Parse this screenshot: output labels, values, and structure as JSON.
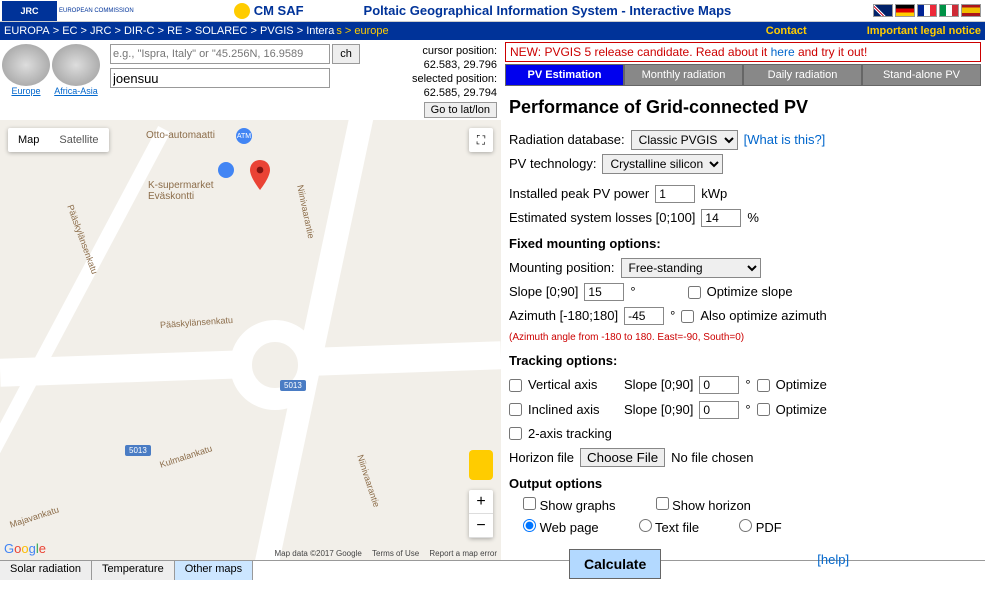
{
  "header": {
    "logo_jrc": "JRC",
    "logo_ec": "EUROPEAN COMMISSION",
    "cmsaf": "CM SAF",
    "title": "Poltaic Geographical Information System - Interactive Maps"
  },
  "breadcrumb": {
    "items": [
      "EUROPA",
      "EC",
      "JRC",
      "DIR-C",
      "RE",
      "SOLAREC",
      "PVGIS",
      "Intera"
    ],
    "ext": "s > europe",
    "contact": "Contact",
    "legal": "Important legal notice"
  },
  "globes": {
    "europe": "Europe",
    "africa": "Africa-Asia"
  },
  "search": {
    "placeholder": "e.g., \"Ispra, Italy\" or \"45.256N, 16.9589",
    "btn": "ch",
    "value": "joensuu",
    "go": "Go to lat/lon"
  },
  "coords": {
    "cursor_label": "cursor position:",
    "cursor_val": "62.583, 29.796",
    "sel_label": "selected position:",
    "sel_val": "62.585, 29.794"
  },
  "map": {
    "type_map": "Map",
    "type_sat": "Satellite",
    "poi_otto": "Otto-automaatti",
    "poi_ksuper": "K-supermarket\nEväskontti",
    "street1": "Pääskylänsenkatu",
    "street2": "Niinivaarantie",
    "street3": "Kulmalankatu",
    "street4": "Majavankatu",
    "street5": "Niinivaarantie",
    "street6": "Pääskylänsenkatu",
    "road": "5013",
    "google": "Google",
    "attr1": "Map data ©2017 Google",
    "attr2": "Terms of Use",
    "attr3": "Report a map error"
  },
  "news": {
    "p1": "NEW: PVGIS 5 release candidate. Read about it ",
    "link": "here",
    "p2": " and try it out!"
  },
  "tabs": [
    "PV Estimation",
    "Monthly radiation",
    "Daily radiation",
    "Stand-alone PV"
  ],
  "panel": {
    "title": "Performance of Grid-connected PV",
    "rad_db_label": "Radiation database:",
    "rad_db_val": "Classic PVGIS",
    "what": "[What is this?]",
    "pvtech_label": "PV technology:",
    "pvtech_val": "Crystalline silicon",
    "peak_label": "Installed peak PV power",
    "peak_val": "1",
    "peak_unit": "kWp",
    "loss_label": "Estimated system losses [0;100]",
    "loss_val": "14",
    "loss_unit": "%",
    "fixed": "Fixed mounting options:",
    "mount_label": "Mounting position:",
    "mount_val": "Free-standing",
    "slope_label": "Slope [0;90]",
    "slope_val": "15",
    "deg": "°",
    "opt_slope": "Optimize slope",
    "az_label": "Azimuth [-180;180]",
    "az_val": "-45",
    "opt_az": "Also optimize azimuth",
    "az_note": "(Azimuth angle from -180 to 180. East=-90, South=0)",
    "tracking": "Tracking options:",
    "vert": "Vertical axis",
    "t_slope_label": "Slope [0;90]",
    "t_slope_val": "0",
    "opt": "Optimize",
    "incl": "Inclined axis",
    "t_slope2_val": "0",
    "two_axis": "2-axis tracking",
    "horizon_label": "Horizon file",
    "choose": "Choose File",
    "nofile": "No file chosen",
    "output": "Output options",
    "show_graphs": "Show graphs",
    "show_horizon": "Show horizon",
    "web": "Web page",
    "text": "Text file",
    "pdf": "PDF",
    "calc": "Calculate",
    "help": "[help]"
  },
  "footer": {
    "solar": "Solar radiation",
    "temp": "Temperature",
    "other": "Other maps"
  }
}
